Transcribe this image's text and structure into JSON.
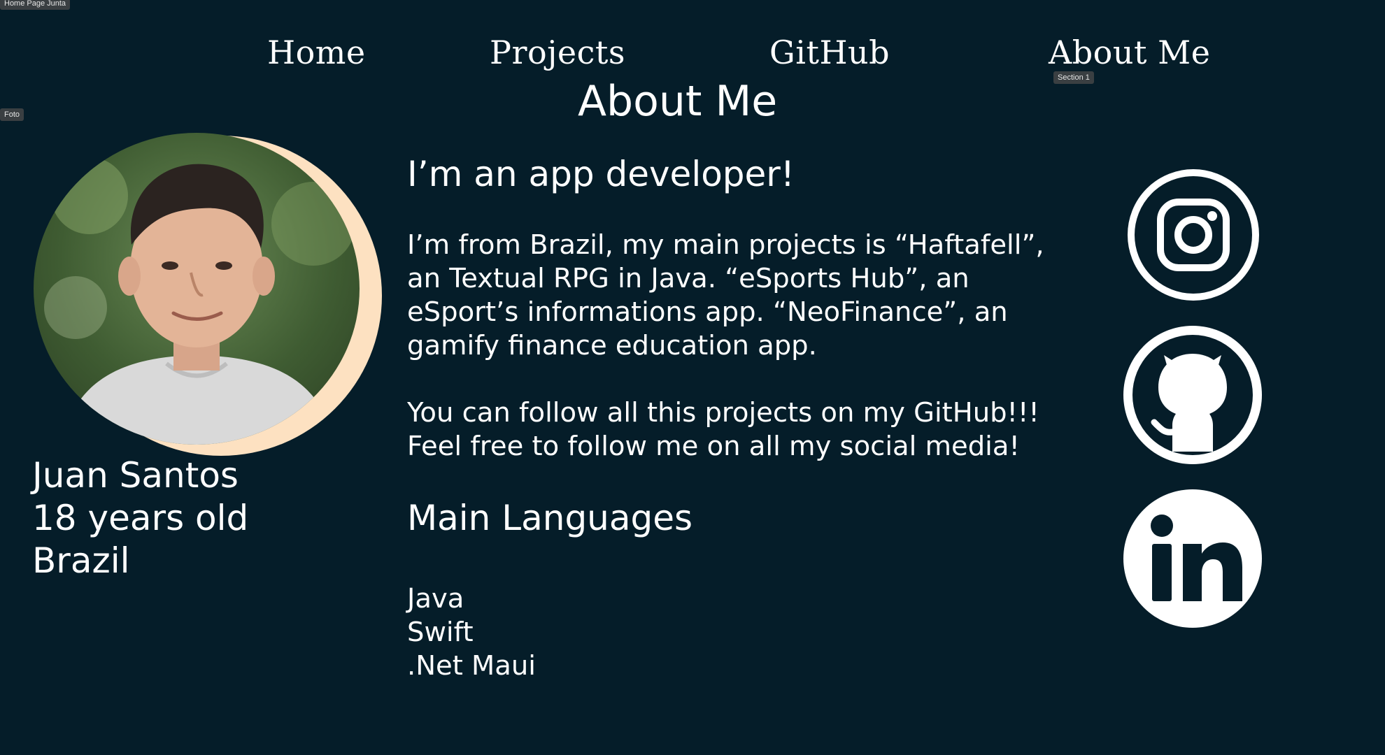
{
  "editor_tags": {
    "home_frame": "Home Page Junta",
    "photo_layer": "Foto",
    "section": "Section 1"
  },
  "nav": {
    "home": "Home",
    "projects": "Projects",
    "github": "GitHub",
    "about": "About Me"
  },
  "page_title": "About Me",
  "profile": {
    "name": "Juan Santos",
    "age": "18 years old",
    "country": "Brazil",
    "photo_icon": "profile-photo"
  },
  "about": {
    "headline": "I’m an app developer!",
    "intro": "I’m from Brazil, my main projects is “Haftafell”, an Textual RPG in Java. “eSports Hub”, an eSport’s informations app. “NeoFinance”, an gamify finance education app.",
    "follow_line1": "You can follow all this projects on my GitHub!!!",
    "follow_line2": "Feel free to follow me on all my social media!"
  },
  "languages": {
    "title": "Main Languages",
    "items": [
      "Java",
      "Swift",
      ".Net Maui"
    ]
  },
  "social": {
    "instagram_icon": "instagram-icon",
    "github_icon": "github-icon",
    "linkedin_icon": "linkedin-icon"
  },
  "colors": {
    "background": "#051d29",
    "text": "#ffffff",
    "photo_accent": "#fde1c1"
  }
}
